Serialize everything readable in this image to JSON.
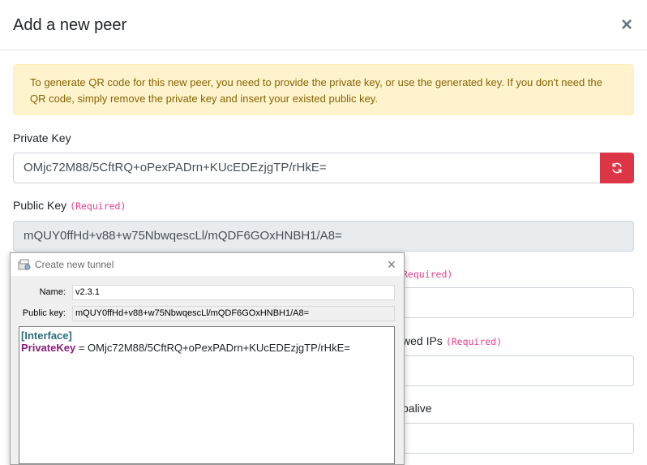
{
  "dialog": {
    "title": "Add a new peer",
    "close_label": "×",
    "alert_text": "To generate QR code for this new peer, you need to provide the private key, or use the generated key. If you don't need the QR code, simply remove the private key and insert your existed public key.",
    "private_key": {
      "label": "Private Key",
      "value": "OMjc72M88/5CftRQ+oPexPADrn+KUcEDEzjgTP/rHkE="
    },
    "public_key": {
      "label": "Public Key",
      "required": "(Required)",
      "value": "mQUY0ffHd+v88+w75NbwqescLl/mQDF6GOxHNBH1/A8="
    },
    "hidden_field_1": {
      "label_fragment": "Required)"
    },
    "hidden_field_2": {
      "label_fragment": "wed IPs",
      "required": "(Required)"
    },
    "hidden_field_3": {
      "label_fragment": "palive"
    }
  },
  "tunnel_window": {
    "title": "Create new tunnel",
    "name_label": "Name:",
    "name_value": "v2.3.1",
    "public_key_label": "Public key:",
    "public_key_value": "mQUY0ffHd+v88+w75NbwqescLl/mQDF6GOxHNBH1/A8=",
    "config": {
      "section": "[Interface]",
      "key": "PrivateKey",
      "eq": " = ",
      "value": "OMjc72M88/5CftRQ+oPexPADrn+KUcEDEzjgTP/rHkE="
    }
  },
  "colors": {
    "danger": "#dc3545",
    "alert_bg": "#fff3cd",
    "required": "#e83e8c"
  }
}
